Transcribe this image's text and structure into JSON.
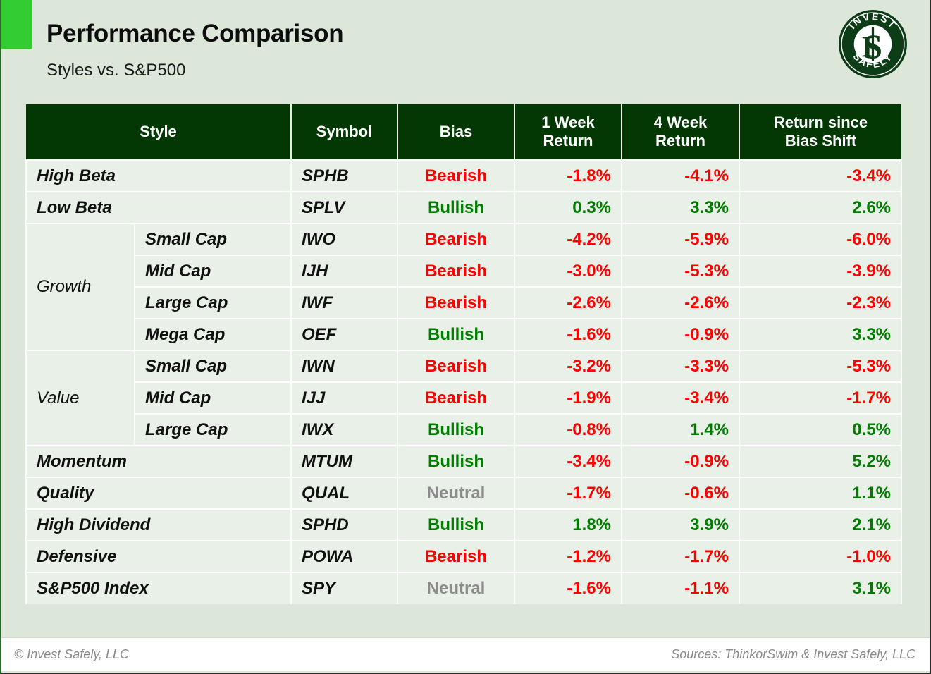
{
  "header": {
    "title": "Performance Comparison",
    "subtitle": "Styles vs. S&P500",
    "accent_color": "#33cc33",
    "background_color": "#dce7da"
  },
  "logo": {
    "name": "invest-safely-logo",
    "top_text": "INVEST",
    "bottom_text": "SAFELY",
    "monogram": "IS",
    "color": "#0c3d17"
  },
  "table": {
    "header_bg": "#033805",
    "columns": [
      {
        "key": "style",
        "label": "Style"
      },
      {
        "key": "symbol",
        "label": "Symbol"
      },
      {
        "key": "bias",
        "label": "Bias"
      },
      {
        "key": "week1",
        "label": "1 Week\nReturn",
        "line1": "1 Week",
        "line2": "Return"
      },
      {
        "key": "week4",
        "label": "4 Week\nReturn",
        "line1": "4 Week",
        "line2": "Return"
      },
      {
        "key": "since",
        "label": "Return since\nBias Shift",
        "line1": "Return since",
        "line2": "Bias Shift"
      }
    ],
    "rows": [
      {
        "style": "High Beta",
        "group": null,
        "symbol": "SPHB",
        "bias": "Bearish",
        "bias_state": "bearish",
        "week1": "-1.8%",
        "week4": "-4.1%",
        "since": "-3.4%",
        "week1_sign": "neg",
        "week4_sign": "neg",
        "since_sign": "neg"
      },
      {
        "style": "Low Beta",
        "group": null,
        "symbol": "SPLV",
        "bias": "Bullish",
        "bias_state": "bullish",
        "week1": "0.3%",
        "week4": "3.3%",
        "since": "2.6%",
        "week1_sign": "pos",
        "week4_sign": "pos",
        "since_sign": "pos"
      },
      {
        "style": "Small Cap",
        "group": "Growth",
        "symbol": "IWO",
        "bias": "Bearish",
        "bias_state": "bearish",
        "week1": "-4.2%",
        "week4": "-5.9%",
        "since": "-6.0%",
        "week1_sign": "neg",
        "week4_sign": "neg",
        "since_sign": "neg"
      },
      {
        "style": "Mid Cap",
        "group": "Growth",
        "symbol": "IJH",
        "bias": "Bearish",
        "bias_state": "bearish",
        "week1": "-3.0%",
        "week4": "-5.3%",
        "since": "-3.9%",
        "week1_sign": "neg",
        "week4_sign": "neg",
        "since_sign": "neg"
      },
      {
        "style": "Large Cap",
        "group": "Growth",
        "symbol": "IWF",
        "bias": "Bearish",
        "bias_state": "bearish",
        "week1": "-2.6%",
        "week4": "-2.6%",
        "since": "-2.3%",
        "week1_sign": "neg",
        "week4_sign": "neg",
        "since_sign": "neg"
      },
      {
        "style": "Mega Cap",
        "group": "Growth",
        "symbol": "OEF",
        "bias": "Bullish",
        "bias_state": "bullish",
        "week1": "-1.6%",
        "week4": "-0.9%",
        "since": "3.3%",
        "week1_sign": "neg",
        "week4_sign": "neg",
        "since_sign": "pos"
      },
      {
        "style": "Small Cap",
        "group": "Value",
        "symbol": "IWN",
        "bias": "Bearish",
        "bias_state": "bearish",
        "week1": "-3.2%",
        "week4": "-3.3%",
        "since": "-5.3%",
        "week1_sign": "neg",
        "week4_sign": "neg",
        "since_sign": "neg"
      },
      {
        "style": "Mid Cap",
        "group": "Value",
        "symbol": "IJJ",
        "bias": "Bearish",
        "bias_state": "bearish",
        "week1": "-1.9%",
        "week4": "-3.4%",
        "since": "-1.7%",
        "week1_sign": "neg",
        "week4_sign": "neg",
        "since_sign": "neg"
      },
      {
        "style": "Large Cap",
        "group": "Value",
        "symbol": "IWX",
        "bias": "Bullish",
        "bias_state": "bullish",
        "week1": "-0.8%",
        "week4": "1.4%",
        "since": "0.5%",
        "week1_sign": "neg",
        "week4_sign": "pos",
        "since_sign": "pos"
      },
      {
        "style": "Momentum",
        "group": null,
        "symbol": "MTUM",
        "bias": "Bullish",
        "bias_state": "bullish",
        "week1": "-3.4%",
        "week4": "-0.9%",
        "since": "5.2%",
        "week1_sign": "neg",
        "week4_sign": "neg",
        "since_sign": "pos"
      },
      {
        "style": "Quality",
        "group": null,
        "symbol": "QUAL",
        "bias": "Neutral",
        "bias_state": "neutral",
        "week1": "-1.7%",
        "week4": "-0.6%",
        "since": "1.1%",
        "week1_sign": "neg",
        "week4_sign": "neg",
        "since_sign": "pos"
      },
      {
        "style": "High Dividend",
        "group": null,
        "symbol": "SPHD",
        "bias": "Bullish",
        "bias_state": "bullish",
        "week1": "1.8%",
        "week4": "3.9%",
        "since": "2.1%",
        "week1_sign": "pos",
        "week4_sign": "pos",
        "since_sign": "pos"
      },
      {
        "style": "Defensive",
        "group": null,
        "symbol": "POWA",
        "bias": "Bearish",
        "bias_state": "bearish",
        "week1": "-1.2%",
        "week4": "-1.7%",
        "since": "-1.0%",
        "week1_sign": "neg",
        "week4_sign": "neg",
        "since_sign": "neg"
      },
      {
        "style": "S&P500 Index",
        "group": null,
        "symbol": "SPY",
        "bias": "Neutral",
        "bias_state": "neutral",
        "week1": "-1.6%",
        "week4": "-1.1%",
        "since": "3.1%",
        "week1_sign": "neg",
        "week4_sign": "neg",
        "since_sign": "pos"
      }
    ],
    "colors": {
      "bearish": "#ff0000",
      "bullish": "#007d00",
      "neutral": "#8c8c8c",
      "negative": "#ff0000",
      "positive": "#007d00"
    }
  },
  "footer": {
    "copyright": "© Invest Safely, LLC",
    "sources": "Sources: ThinkorSwim & Invest Safely, LLC"
  }
}
